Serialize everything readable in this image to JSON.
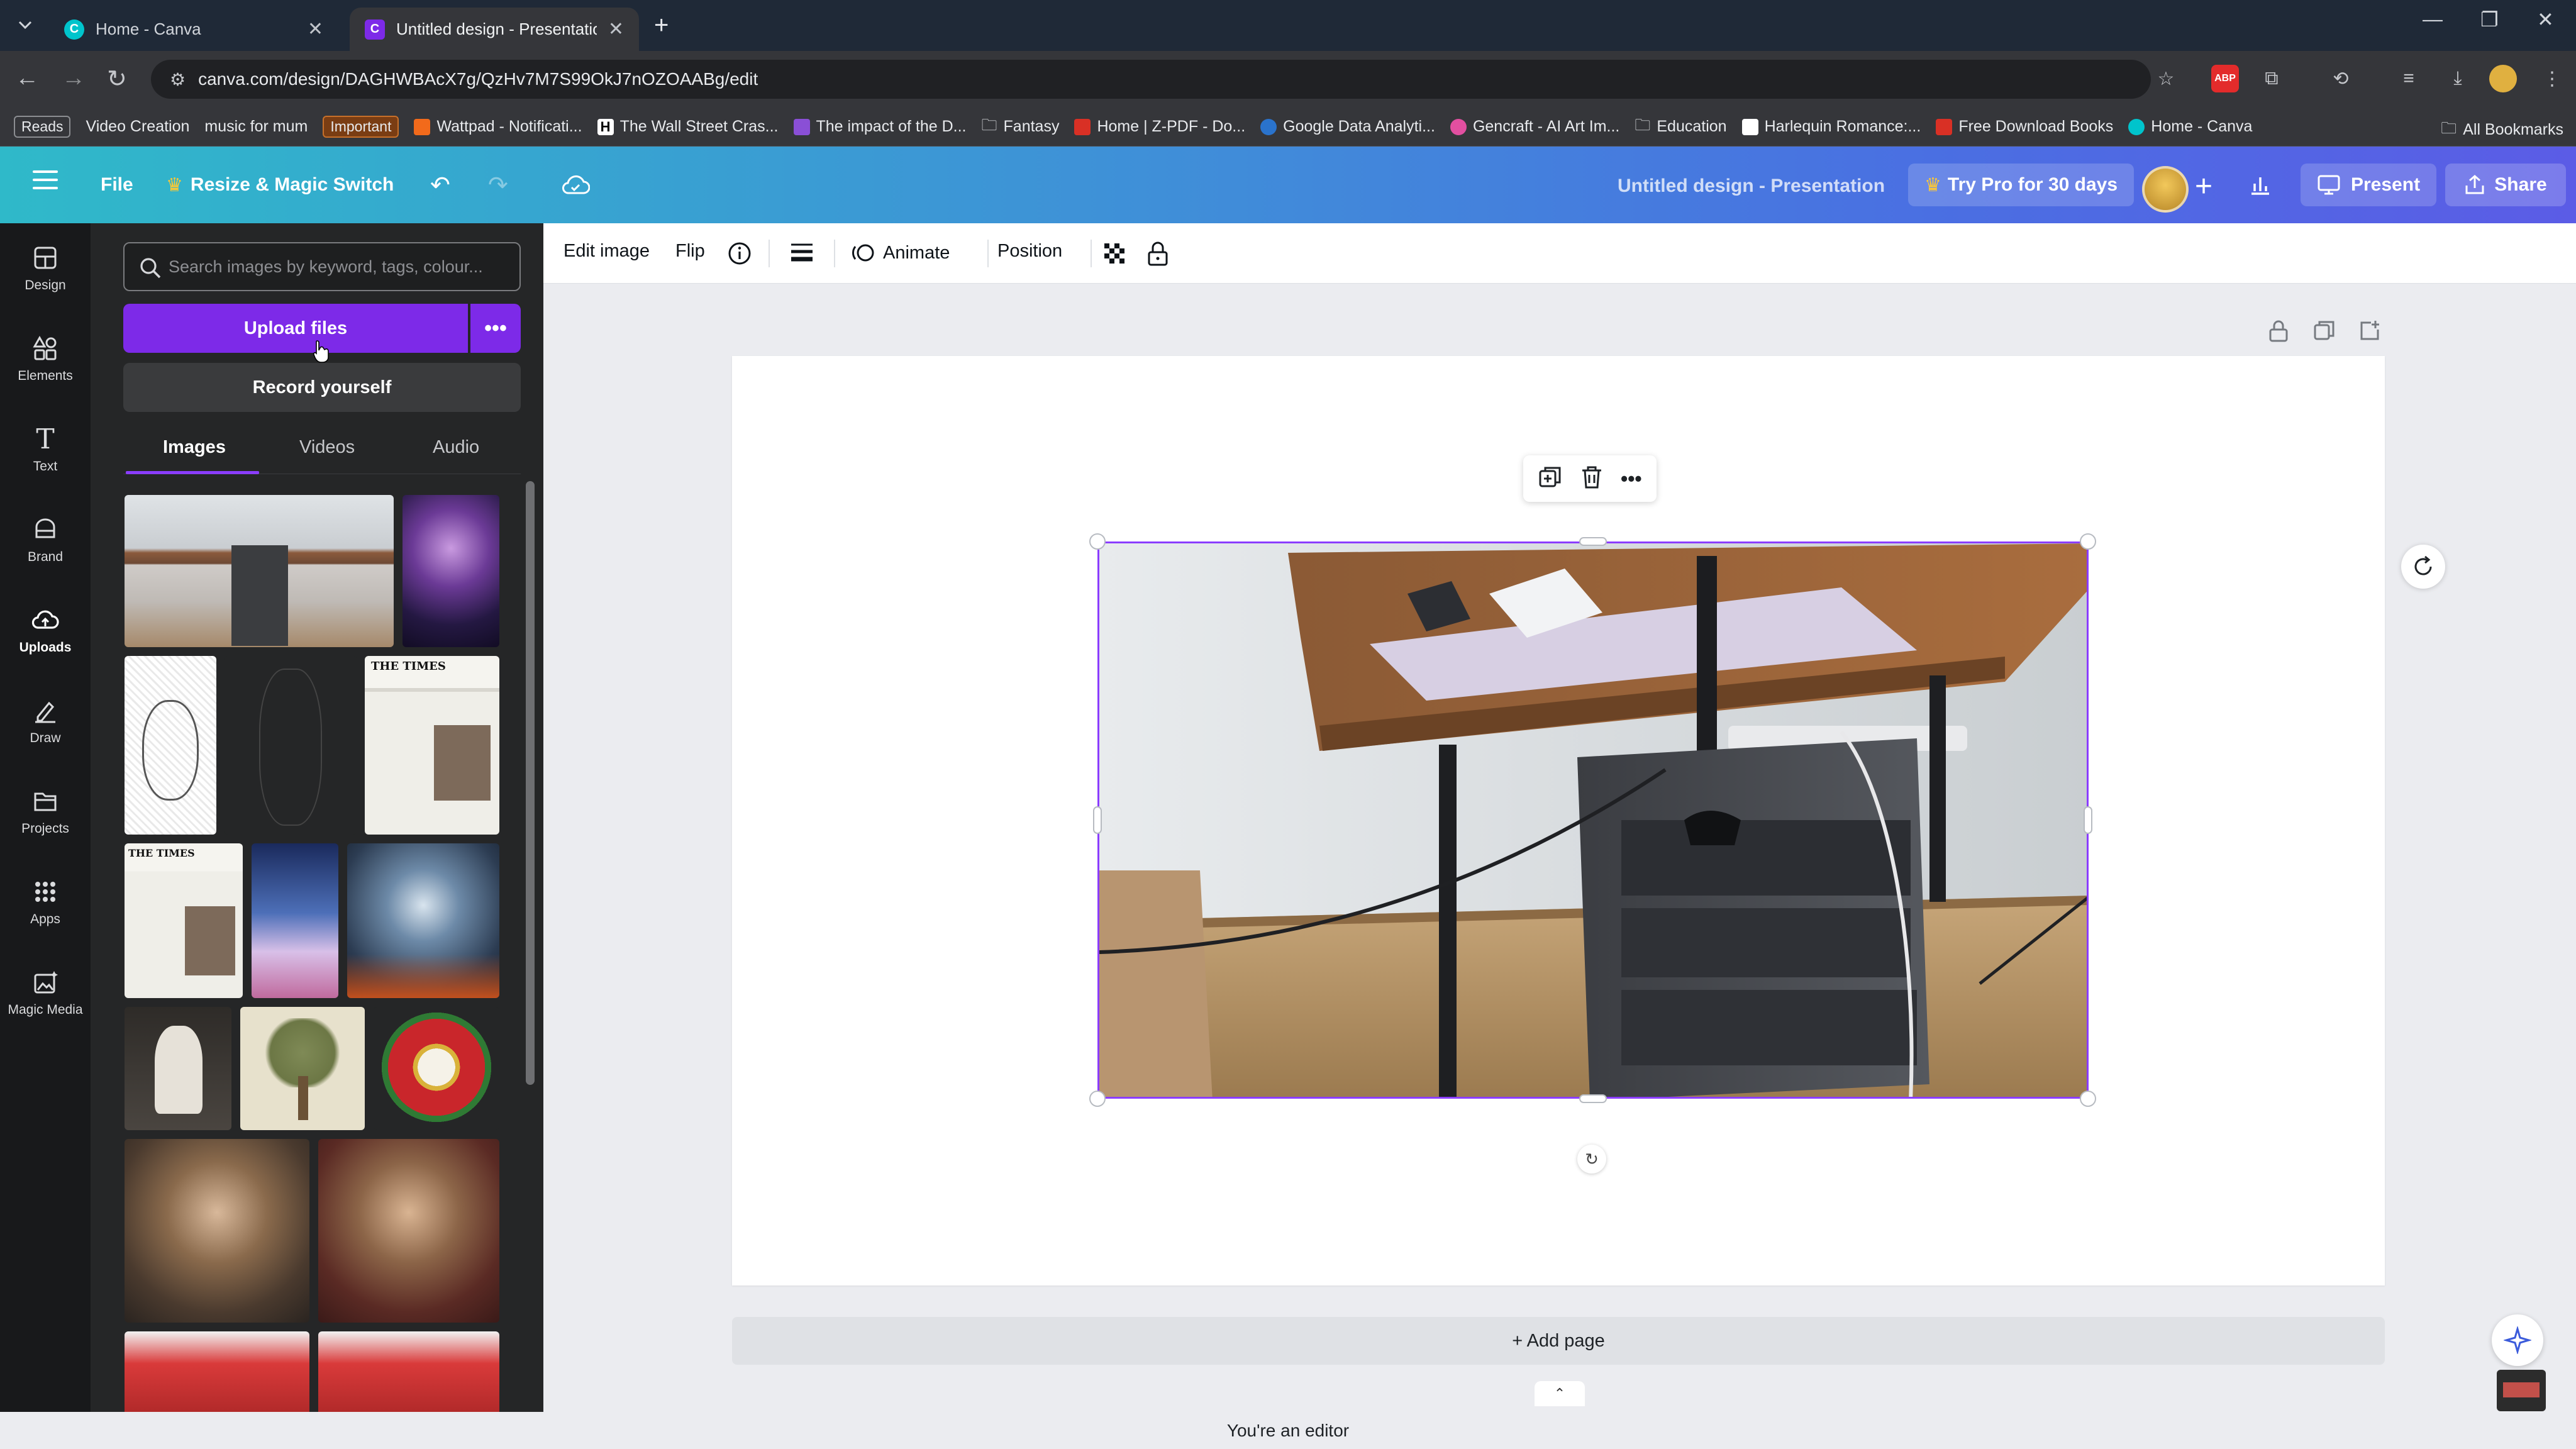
{
  "browser": {
    "tabs": [
      {
        "title": "Home - Canva",
        "active": false
      },
      {
        "title": "Untitled design - Presentation",
        "active": true
      }
    ],
    "url": "canva.com/design/DAGHWBAcX7g/QzHv7M7S99OkJ7nOZOAABg/edit",
    "bookmarks": [
      {
        "label": "Reads",
        "style": "chip"
      },
      {
        "label": "Video Creation",
        "style": "plain"
      },
      {
        "label": "music for mum",
        "style": "plain"
      },
      {
        "label": "Important",
        "style": "chip-orange"
      },
      {
        "label": "Wattpad - Notificati...",
        "icon": "wattpad-icon",
        "color": "#f26a1b"
      },
      {
        "label": "The Wall Street Cras...",
        "icon": "wsj-icon",
        "color": "#ffffff"
      },
      {
        "label": "The impact of the D...",
        "icon": "bookmark-icon",
        "color": "#8a4fd6"
      },
      {
        "label": "Fantasy",
        "icon": "folder-icon",
        "color": ""
      },
      {
        "label": "Home | Z-PDF - Do...",
        "icon": "zpdf-icon",
        "color": "#d93025"
      },
      {
        "label": "Google Data Analyti...",
        "icon": "coursera-icon",
        "color": "#2a73cc"
      },
      {
        "label": "Gencraft - AI Art Im...",
        "icon": "gencraft-icon",
        "color": "#e24fa0"
      },
      {
        "label": "Education",
        "icon": "folder-icon",
        "color": ""
      },
      {
        "label": "Harlequin Romance:...",
        "icon": "harlequin-icon",
        "color": "#ffffff"
      },
      {
        "label": "Free Download Books",
        "icon": "books-icon",
        "color": "#d93025"
      },
      {
        "label": "Home - Canva",
        "icon": "canva-icon",
        "color": "#00c4cc"
      }
    ],
    "all_bookmarks": "All Bookmarks"
  },
  "header": {
    "file": "File",
    "resize": "Resize & Magic Switch",
    "design_title": "Untitled design - Presentation",
    "pro": "Try Pro for 30 days",
    "present": "Present",
    "share": "Share"
  },
  "rail": [
    {
      "label": "Design",
      "icon": "design-icon"
    },
    {
      "label": "Elements",
      "icon": "elements-icon"
    },
    {
      "label": "Text",
      "icon": "text-icon"
    },
    {
      "label": "Brand",
      "icon": "brand-icon"
    },
    {
      "label": "Uploads",
      "icon": "cloud-upload-icon",
      "active": true
    },
    {
      "label": "Draw",
      "icon": "draw-icon"
    },
    {
      "label": "Projects",
      "icon": "folder-icon"
    },
    {
      "label": "Apps",
      "icon": "apps-grid-icon"
    },
    {
      "label": "Magic Media",
      "icon": "magic-media-icon"
    }
  ],
  "panel": {
    "search_placeholder": "Search images by keyword, tags, colour...",
    "upload": "Upload files",
    "record": "Record yourself",
    "tabs": [
      "Images",
      "Videos",
      "Audio"
    ]
  },
  "toolbar": {
    "edit_image": "Edit image",
    "flip": "Flip",
    "animate": "Animate",
    "position": "Position"
  },
  "canvas": {
    "add_page": "+ Add page"
  },
  "status": "You're an editor"
}
